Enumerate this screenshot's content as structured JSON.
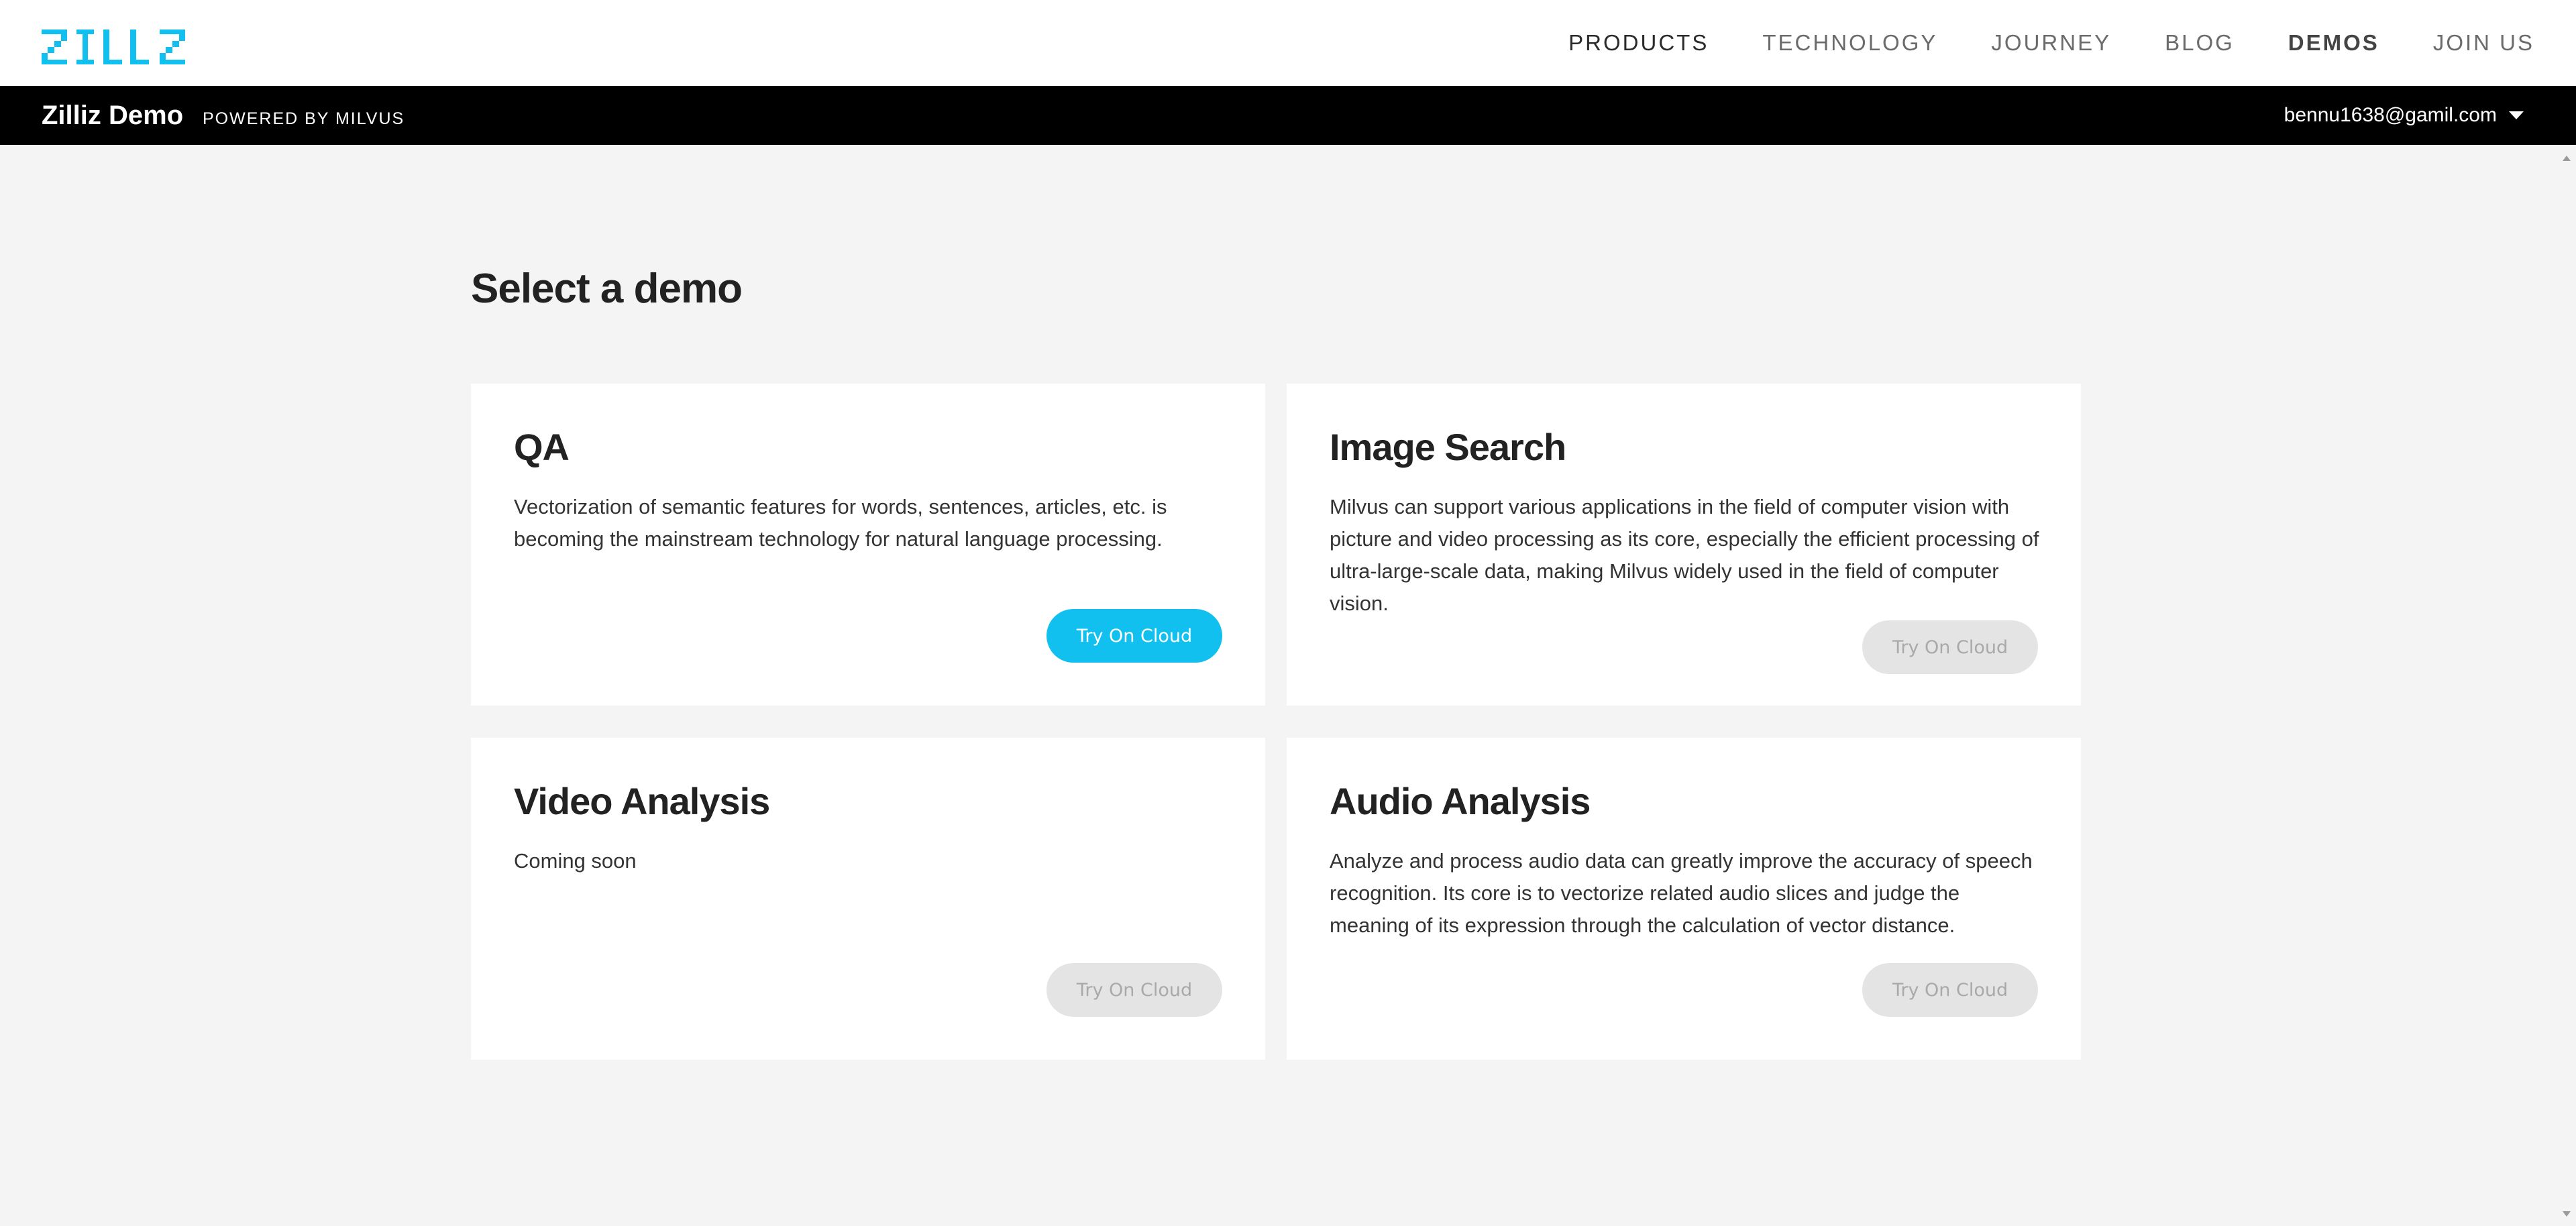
{
  "brand": {
    "logo_text": "ZILLIZ",
    "accent_color": "#12c0ef"
  },
  "topnav": {
    "links": [
      {
        "label": "PRODUCTS"
      },
      {
        "label": "TECHNOLOGY"
      },
      {
        "label": "JOURNEY"
      },
      {
        "label": "BLOG"
      },
      {
        "label": "DEMOS"
      },
      {
        "label": "JOIN US"
      }
    ],
    "active": "DEMOS"
  },
  "subbar": {
    "title": "Zilliz Demo",
    "powered_by": "POWERED BY MILVUS",
    "user_email": "bennu1638@gamil.com",
    "user_menu_icon": "caret-down-icon"
  },
  "main": {
    "heading": "Select a demo",
    "cards": [
      {
        "title": "QA",
        "description": "Vectorization of semantic features for words, sentences, articles, etc. is becoming the mainstream technology for natural language processing.",
        "button_label": "Try On Cloud",
        "button_state": "enabled"
      },
      {
        "title": "Image Search",
        "description": "Milvus can support various applications in the field of computer vision with picture and video processing as its core, especially the efficient processing of ultra-large-scale data, making Milvus widely used in the field of computer vision.",
        "button_label": "Try On Cloud",
        "button_state": "disabled"
      },
      {
        "title": "Video Analysis",
        "description": "Coming soon",
        "button_label": "Try On Cloud",
        "button_state": "disabled"
      },
      {
        "title": "Audio Analysis",
        "description": "Analyze and process audio data can greatly improve the accuracy of speech recognition. Its core is to vectorize related audio slices and judge the meaning of its expression through the calculation of vector distance.",
        "button_label": "Try On Cloud",
        "button_state": "disabled"
      }
    ]
  }
}
